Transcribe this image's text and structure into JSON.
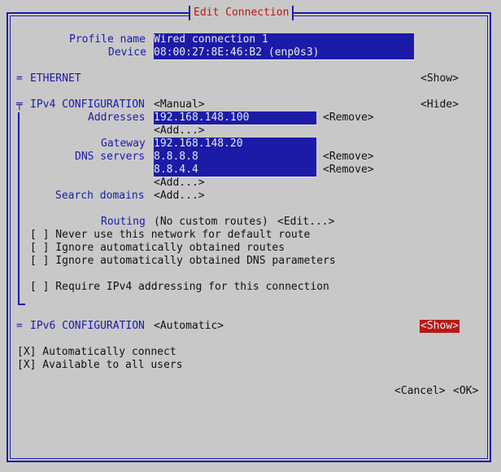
{
  "title": "Edit Connection",
  "profile": {
    "name_label": "Profile name",
    "name_value": "Wired connection 1",
    "device_label": "Device",
    "device_value": "08:00:27:8E:46:B2 (enp0s3)"
  },
  "ethernet": {
    "marker": "=",
    "label": "ETHERNET",
    "toggle": "<Show>"
  },
  "ipv4": {
    "marker": "╤",
    "label": "IPv4 CONFIGURATION",
    "mode": "<Manual>",
    "toggle": "<Hide>",
    "addresses_label": "Addresses",
    "addresses": [
      "192.168.148.100"
    ],
    "remove": "<Remove>",
    "add": "<Add...>",
    "gateway_label": "Gateway",
    "gateway_value": "192.168.148.20",
    "dns_label": "DNS servers",
    "dns": [
      "8.8.8.8",
      "8.8.4.4"
    ],
    "search_label": "Search domains",
    "routing_label": "Routing",
    "routing_value": "(No custom routes)",
    "edit": "<Edit...>",
    "checkboxes": [
      "[ ] Never use this network for default route",
      "[ ] Ignore automatically obtained routes",
      "[ ] Ignore automatically obtained DNS parameters"
    ],
    "require": "[ ] Require IPv4 addressing for this connection"
  },
  "ipv6": {
    "marker": "=",
    "label": "IPv6 CONFIGURATION",
    "mode": "<Automatic>",
    "toggle": "<Show>"
  },
  "options": {
    "auto_connect": "[X] Automatically connect",
    "all_users": "[X] Available to all users"
  },
  "buttons": {
    "cancel": "<Cancel>",
    "ok": "<OK>"
  }
}
